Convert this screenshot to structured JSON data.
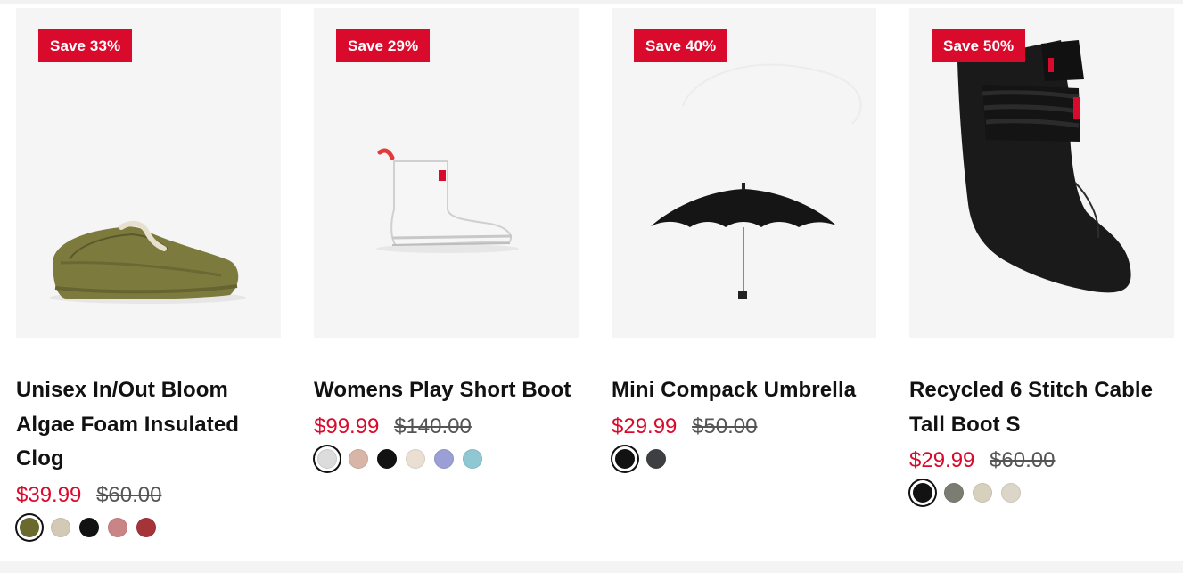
{
  "products": [
    {
      "badge": "Save 33%",
      "title": "Unisex In/Out Bloom Algae Foam Insulated Clog",
      "sale_price": "$39.99",
      "original_price": "$60.00",
      "image_icon": "clog-icon",
      "swatches": [
        {
          "name": "olive",
          "color": "#6b6a2e",
          "selected": true
        },
        {
          "name": "sand",
          "color": "#d3cab6"
        },
        {
          "name": "black",
          "color": "#121212"
        },
        {
          "name": "rose",
          "color": "#c98486"
        },
        {
          "name": "burgundy",
          "color": "#a4343a"
        }
      ]
    },
    {
      "badge": "Save 29%",
      "title": "Womens Play Short Boot",
      "sale_price": "$99.99",
      "original_price": "$140.00",
      "image_icon": "rain-boot-icon",
      "swatches": [
        {
          "name": "light-grey",
          "color": "#dcdcdc",
          "selected": true
        },
        {
          "name": "blush",
          "color": "#d8b5a6"
        },
        {
          "name": "black",
          "color": "#121212"
        },
        {
          "name": "cream",
          "color": "#eadfd2"
        },
        {
          "name": "lavender",
          "color": "#9aa0d6"
        },
        {
          "name": "aqua",
          "color": "#8fc7d2"
        }
      ]
    },
    {
      "badge": "Save 40%",
      "title": "Mini Compack Umbrella",
      "sale_price": "$29.99",
      "original_price": "$50.00",
      "image_icon": "umbrella-icon",
      "swatches": [
        {
          "name": "black",
          "color": "#121212",
          "selected": true
        },
        {
          "name": "charcoal",
          "color": "#3e3f42"
        }
      ]
    },
    {
      "badge": "Save 50%",
      "title": "Recycled 6 Stitch Cable Tall Boot S",
      "sale_price": "$29.99",
      "original_price": "$60.00",
      "image_icon": "boot-sock-icon",
      "swatches": [
        {
          "name": "black",
          "color": "#121212",
          "selected": true
        },
        {
          "name": "grey-green",
          "color": "#7b7d72"
        },
        {
          "name": "stone",
          "color": "#d6d0bd"
        },
        {
          "name": "light-stone",
          "color": "#dcd6c8"
        }
      ]
    }
  ]
}
